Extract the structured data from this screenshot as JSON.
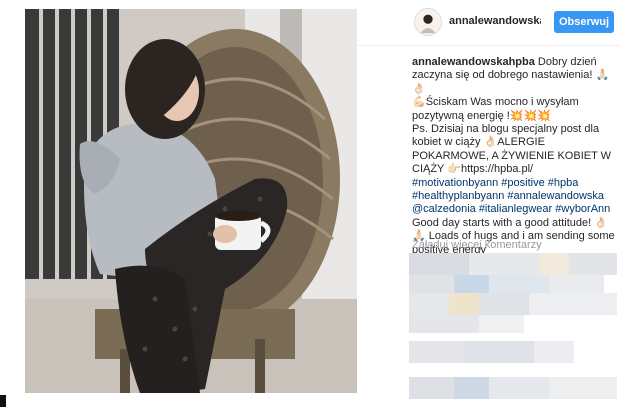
{
  "post": {
    "username": "annalewandowskah",
    "follow_label": "Obserwuj",
    "caption": {
      "author": "annalewandowskahpba",
      "lines": [
        {
          "text": " Dobry dzień zaczyna się od dobrego nastawienia! 🙏🏻👌🏻",
          "type": "text"
        },
        {
          "text": "💪🏻Ściskam Was mocno i wysyłam pozytywną energię !💥💥💥",
          "type": "text"
        },
        {
          "text": "Ps. Dzisiaj na blogu specjalny post dla kobiet w ciąży 👌🏻ALERGIE POKARMOWE, A ŻYWIENIE KOBIET W CIĄŻY 👉🏻https://hpba.pl/",
          "type": "text"
        },
        {
          "text": "#motivationbyann #positive #hpba #healthyplanbyann #annalewandowska @calzedonia #italianlegwear #wyborAnn",
          "type": "tag"
        },
        {
          "text": "Good day starts with a good attitude! 👌🏻🙏🏻 Loads of hugs and i am sending some positive energy",
          "type": "text"
        }
      ]
    },
    "load_more_label": "Załaduj więcej komentarzy"
  },
  "colors": {
    "accent": "#3897f0",
    "tag": "#003569",
    "muted": "#999999"
  },
  "icons": {
    "avatar": "profile-avatar"
  }
}
